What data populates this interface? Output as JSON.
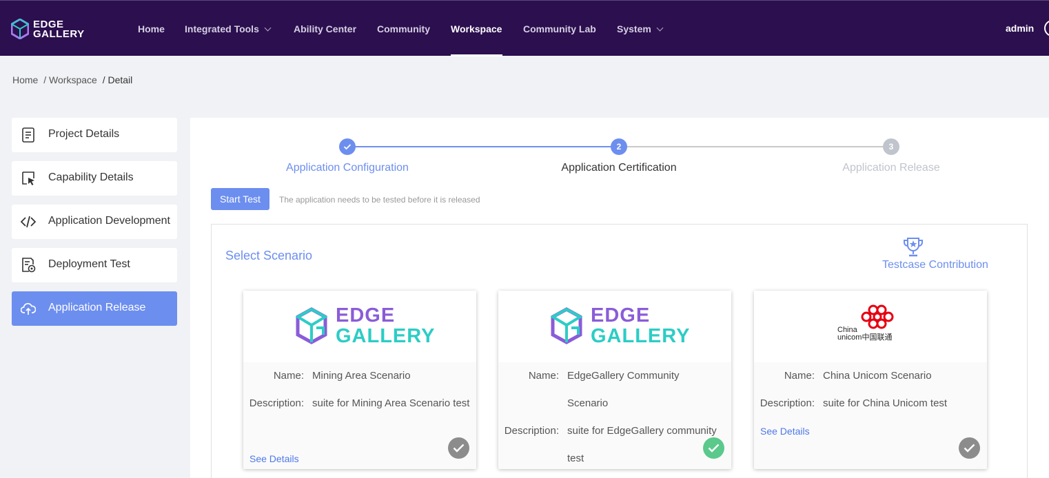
{
  "app": {
    "logo_line1": "EDGE",
    "logo_line2": "GALLERY"
  },
  "nav": {
    "items": [
      {
        "label": "Home"
      },
      {
        "label": "Integrated Tools"
      },
      {
        "label": "Ability Center"
      },
      {
        "label": "Community"
      },
      {
        "label": "Workspace"
      },
      {
        "label": "Community Lab"
      },
      {
        "label": "System"
      }
    ],
    "active": "Workspace",
    "user": "admin"
  },
  "breadcrumb": [
    "Home",
    "/ Workspace",
    "/ Detail"
  ],
  "sidebar": {
    "items": [
      {
        "label": "Project Details",
        "icon": "document-icon"
      },
      {
        "label": "Capability Details",
        "icon": "cursor-icon"
      },
      {
        "label": "Application Development",
        "icon": "code-icon"
      },
      {
        "label": "Deployment Test",
        "icon": "test-report-icon"
      },
      {
        "label": "Application Release",
        "icon": "cloud-upload-icon"
      }
    ],
    "active": "Application Release"
  },
  "steps": [
    {
      "index": "1",
      "label": "Application Configuration",
      "status": "done"
    },
    {
      "index": "2",
      "label": "Application Certification",
      "status": "current"
    },
    {
      "index": "3",
      "label": "Application Release",
      "status": "pending"
    }
  ],
  "actions": {
    "start_test": "Start Test",
    "hint": "The application needs to be tested before it is released"
  },
  "scenario": {
    "title": "Select Scenario",
    "contribution": "Testcase Contribution",
    "name_key": "Name:",
    "desc_key": "Description:",
    "see_details": "See Details",
    "cards": [
      {
        "logo_w1": "EDGE",
        "logo_w2": "GALLERY",
        "name": "Mining Area Scenario",
        "description": "suite for Mining Area Scenario test",
        "selected": false
      },
      {
        "logo_w1": "EDGE",
        "logo_w2": "GALLERY",
        "name": "EdgeGallery Community Scenario",
        "description": "suite for EdgeGallery community test",
        "selected": true
      },
      {
        "logo_w1": "China",
        "logo_w2": "unicom中国联通",
        "name": "China Unicom Scenario",
        "description": "suite for China Unicom test",
        "selected": false
      }
    ]
  },
  "colors": {
    "nav_bg": "#2c0f4f",
    "accent": "#6c8eef",
    "egg_purple": "#8a5cd8",
    "egg_teal": "#2ccdc5",
    "unicom_red": "#e60012",
    "check_gray": "#8c8c8c",
    "check_green": "#5ac98b"
  }
}
